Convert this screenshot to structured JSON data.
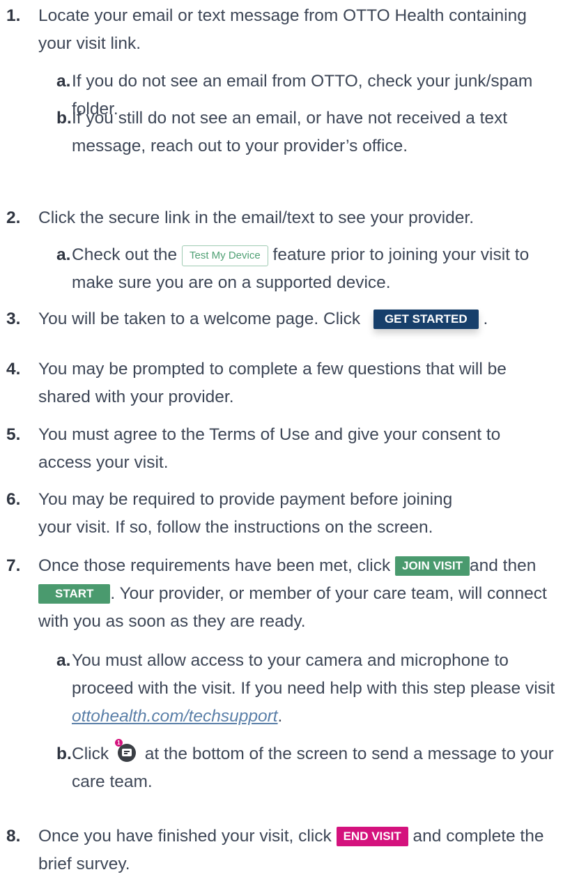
{
  "steps": [
    {
      "num": "1.",
      "text": "Locate your email or text message from OTTO Health containing your visit link.",
      "subs": [
        {
          "num": "a.",
          "text": "If you do not see an email from OTTO, check your junk/spam folder."
        },
        {
          "num": "b.",
          "text": "If you still do not see an email, or have not received a text message, reach out to your provider’s office."
        }
      ]
    },
    {
      "num": "2.",
      "text": "Click the secure link in the email/text to see your provider.",
      "subs": [
        {
          "num": "a.",
          "pre": "Check out the",
          "button": "Test My Device",
          "post": "feature prior to joining your visit to make sure you are on a supported device."
        }
      ]
    },
    {
      "num": "3.",
      "pre": "You will be taken to a welcome page. Click",
      "button": "GET STARTED",
      "post": "."
    },
    {
      "num": "4.",
      "text": "You may be prompted to complete a few questions that will be shared with your provider."
    },
    {
      "num": "5.",
      "text": "You must agree to the Terms of Use and give your consent to access your visit."
    },
    {
      "num": "6.",
      "text": "You may be required to provide payment before joining your visit. If so, follow the instructions on the screen."
    },
    {
      "num": "7.",
      "pre": "Once those requirements have been met, click",
      "button": "JOIN VISIT",
      "mid": "and then",
      "button2": "START",
      "post": ". Your provider, or member of your care team, will connect with you as soon as they are ready.",
      "subs": [
        {
          "num": "a.",
          "pre": "You must allow access to your camera and microphone to proceed with the visit. If you need help with this step please visit",
          "link": "ottohealth.com/techsupport",
          "post": "."
        },
        {
          "num": "b.",
          "pre": "Click",
          "icon": "chat-message-icon",
          "badge": "1",
          "post": "at the bottom of the screen to send a message to your care team."
        }
      ]
    },
    {
      "num": "8.",
      "pre": "Once you have finished your visit, click",
      "button": "END VISIT",
      "post": "and complete the brief survey."
    }
  ],
  "colors": {
    "navy": "#173f6b",
    "green": "#4a9a6e",
    "pink": "#d4127d",
    "link": "#5a7fa8",
    "text": "#3d4656"
  }
}
